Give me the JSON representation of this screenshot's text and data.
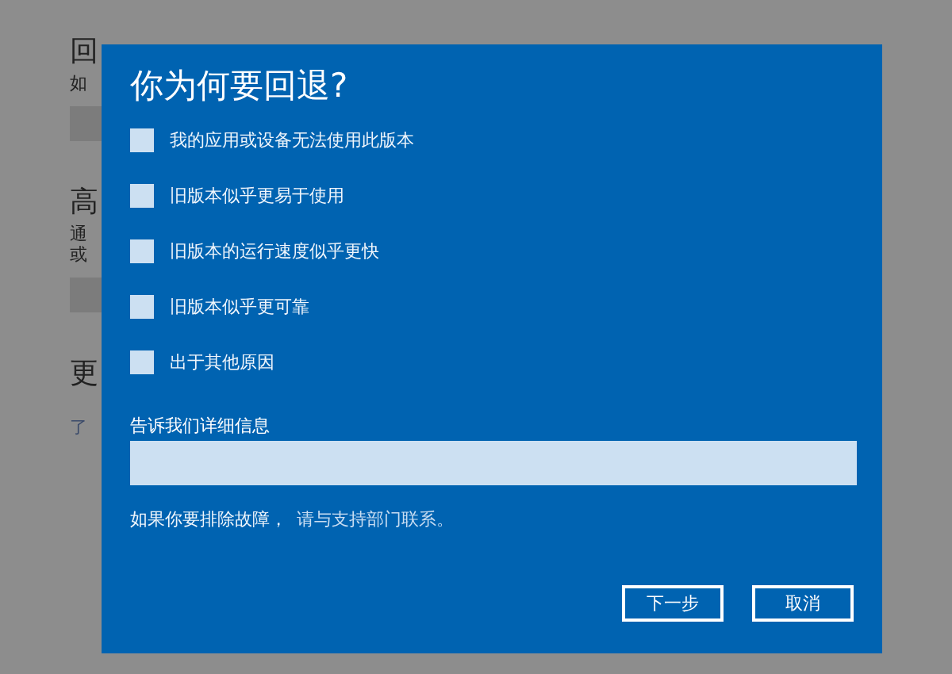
{
  "background": {
    "items": [
      {
        "kind": "heading",
        "text": "回"
      },
      {
        "kind": "text",
        "text": "如"
      },
      {
        "kind": "button"
      },
      {
        "kind": "heading",
        "text": "高"
      },
      {
        "kind": "text",
        "text": "通"
      },
      {
        "kind": "text",
        "text": "或"
      },
      {
        "kind": "button"
      },
      {
        "kind": "heading",
        "text": "更"
      },
      {
        "kind": "link",
        "text": "了"
      }
    ]
  },
  "dialog": {
    "title": "你为何要回退?",
    "reasons": [
      {
        "label": "我的应用或设备无法使用此版本",
        "checked": false
      },
      {
        "label": "旧版本似乎更易于使用",
        "checked": false
      },
      {
        "label": "旧版本的运行速度似乎更快",
        "checked": false
      },
      {
        "label": "旧版本似乎更可靠",
        "checked": false
      },
      {
        "label": "出于其他原因",
        "checked": false
      }
    ],
    "details": {
      "label": "告诉我们详细信息"
    },
    "help": {
      "text": "如果你要排除故障，",
      "link": "请与支持部门联系。"
    },
    "buttons": [
      {
        "label": "下一步"
      },
      {
        "label": "取消"
      }
    ]
  }
}
